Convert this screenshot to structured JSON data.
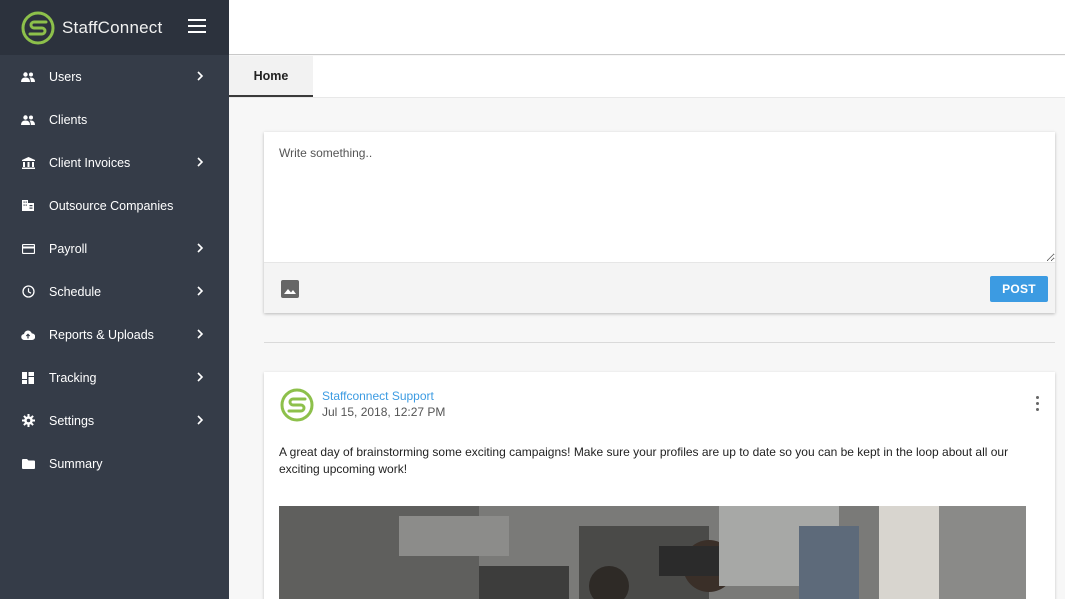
{
  "brand": {
    "name": "StaffConnect",
    "accent": "#8dc04b"
  },
  "sidebar": {
    "items": [
      {
        "label": "Users",
        "icon": "users-icon",
        "has_submenu": true
      },
      {
        "label": "Clients",
        "icon": "clients-icon",
        "has_submenu": false
      },
      {
        "label": "Client Invoices",
        "icon": "bank-icon",
        "has_submenu": true
      },
      {
        "label": "Outsource Companies",
        "icon": "building-icon",
        "has_submenu": false
      },
      {
        "label": "Payroll",
        "icon": "credit-card-icon",
        "has_submenu": true
      },
      {
        "label": "Schedule",
        "icon": "clock-icon",
        "has_submenu": true
      },
      {
        "label": "Reports & Uploads",
        "icon": "cloud-upload-icon",
        "has_submenu": true
      },
      {
        "label": "Tracking",
        "icon": "dashboard-icon",
        "has_submenu": true
      },
      {
        "label": "Settings",
        "icon": "gear-icon",
        "has_submenu": true
      },
      {
        "label": "Summary",
        "icon": "folder-icon",
        "has_submenu": false
      }
    ]
  },
  "tabs": {
    "home": "Home"
  },
  "composer": {
    "placeholder": "Write something..",
    "post_label": "POST"
  },
  "post": {
    "author": "Staffconnect Support",
    "date": "Jul 15, 2018, 12:27 PM",
    "body": "A great day of brainstorming some exciting campaigns! Make sure your profiles are up to date so you can be kept in the loop about all our exciting upcoming work!"
  },
  "colors": {
    "sidebar_bg": "#353c48",
    "link": "#3c9be2",
    "button": "#3c9be2"
  }
}
